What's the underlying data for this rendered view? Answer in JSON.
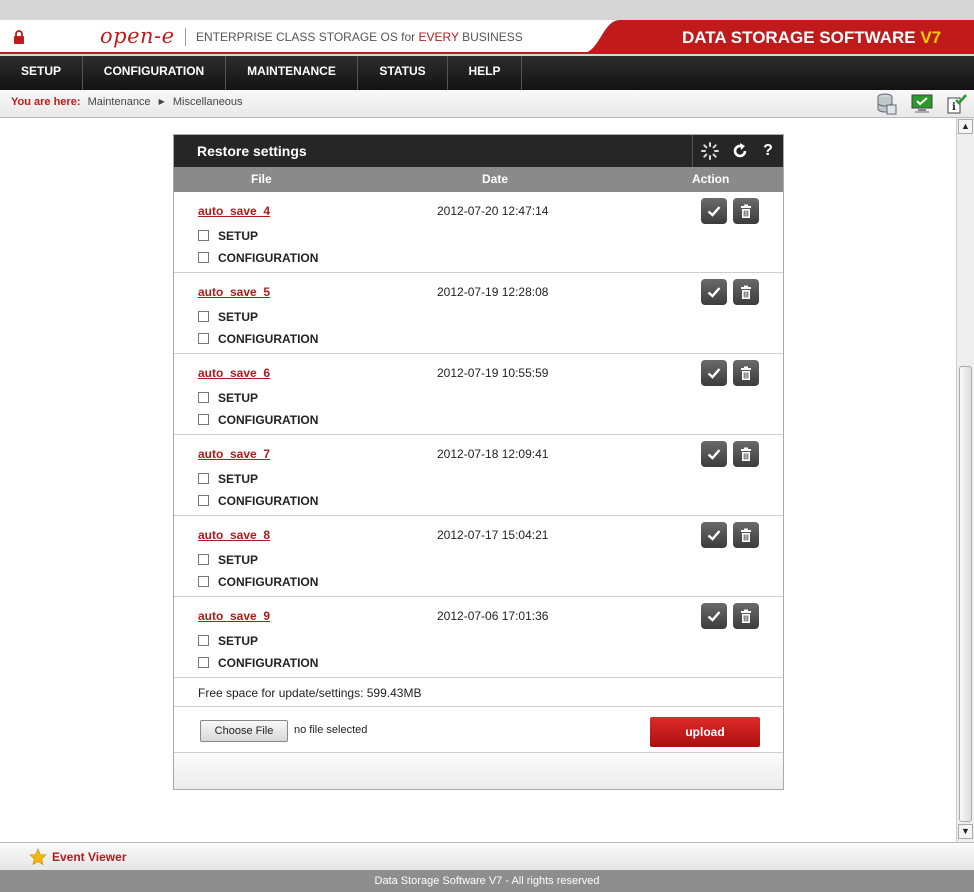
{
  "header": {
    "logo": "open-e",
    "tagline_prefix": "ENTERPRISE CLASS STORAGE OS for ",
    "tagline_highlight": "EVERY",
    "tagline_suffix": " BUSINESS",
    "brand_title": "DATA STORAGE SOFTWARE ",
    "brand_version": "V7",
    "colors": {
      "brand_red": "#c01a1a",
      "version_yellow": "#ffcc00"
    }
  },
  "nav": {
    "items": [
      {
        "label": "SETUP"
      },
      {
        "label": "CONFIGURATION"
      },
      {
        "label": "MAINTENANCE"
      },
      {
        "label": "STATUS"
      },
      {
        "label": "HELP"
      }
    ]
  },
  "breadcrumb": {
    "label": "You are here:",
    "items": [
      "Maintenance",
      "Miscellaneous"
    ]
  },
  "toolbar_icons": [
    "database-icon",
    "monitor-icon",
    "info-check-icon"
  ],
  "panel": {
    "title": "Restore settings",
    "tool_icons": [
      "loading-spinner-icon",
      "refresh-icon",
      "help-icon"
    ],
    "help_glyph": "?",
    "columns": {
      "file": "File",
      "date": "Date",
      "action": "Action"
    },
    "rows": [
      {
        "file": "auto_save_4",
        "date": "2012-07-20 12:47:14",
        "opt1": "SETUP",
        "opt2": "CONFIGURATION"
      },
      {
        "file": "auto_save_5",
        "date": "2012-07-19 12:28:08",
        "opt1": "SETUP",
        "opt2": "CONFIGURATION"
      },
      {
        "file": "auto_save_6",
        "date": "2012-07-19 10:55:59",
        "opt1": "SETUP",
        "opt2": "CONFIGURATION"
      },
      {
        "file": "auto_save_7",
        "date": "2012-07-18 12:09:41",
        "opt1": "SETUP",
        "opt2": "CONFIGURATION"
      },
      {
        "file": "auto_save_8",
        "date": "2012-07-17 15:04:21",
        "opt1": "SETUP",
        "opt2": "CONFIGURATION"
      },
      {
        "file": "auto_save_9",
        "date": "2012-07-06 17:01:36",
        "opt1": "SETUP",
        "opt2": "CONFIGURATION"
      }
    ],
    "free_space": "Free space for update/settings: 599.43MB",
    "choose_file_label": "Choose File",
    "no_file_text": "no file selected",
    "upload_label": "upload"
  },
  "event_viewer": {
    "label": "Event Viewer"
  },
  "footer": {
    "text": "Data Storage Software V7 - All rights reserved"
  }
}
